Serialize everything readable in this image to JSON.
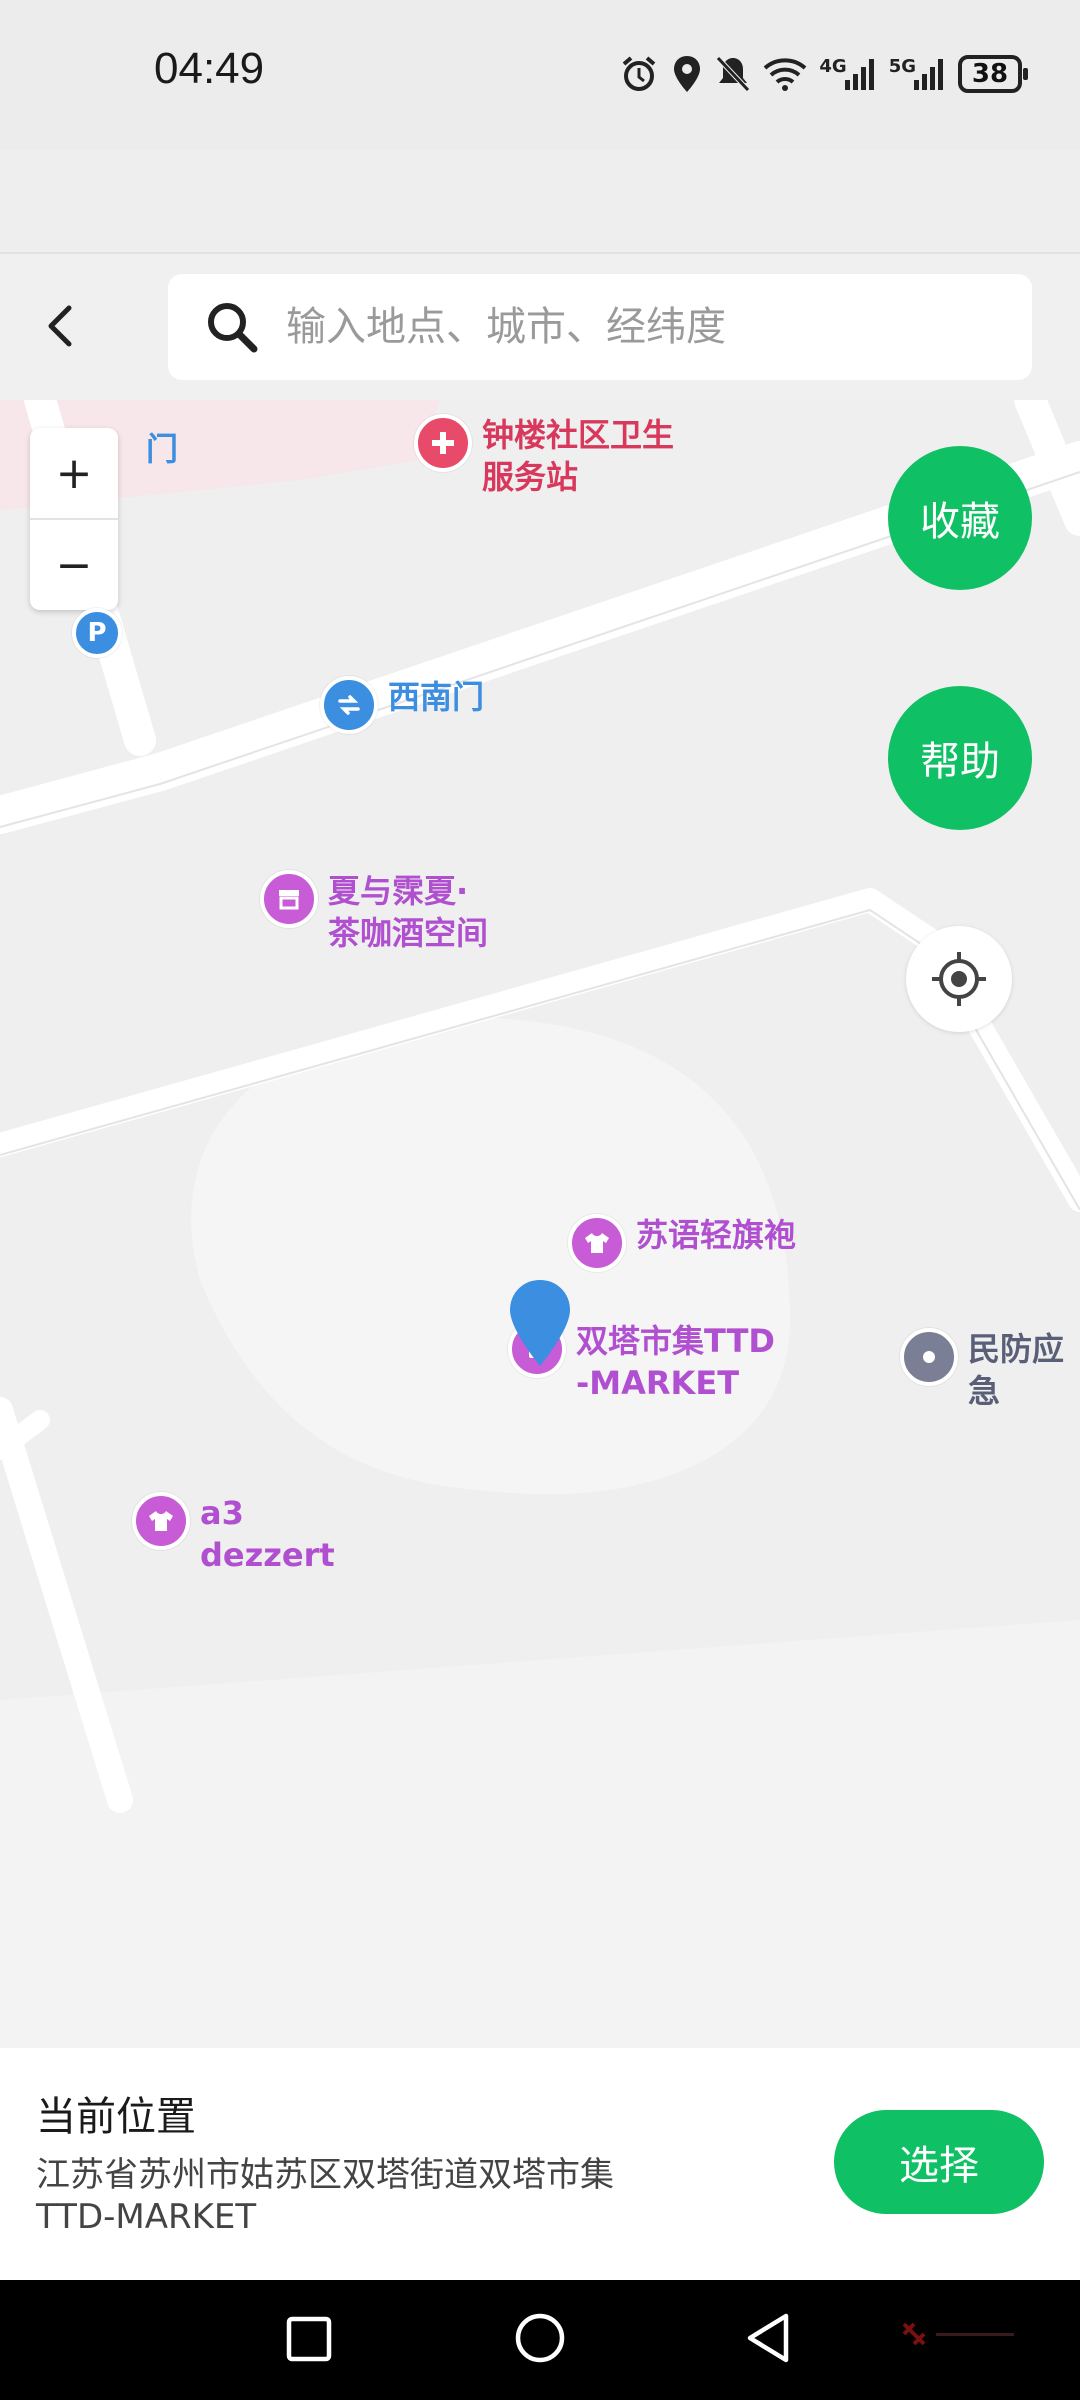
{
  "status_bar": {
    "time": "04:49",
    "battery": "38",
    "icons": [
      "alarm-icon",
      "location-icon",
      "mute-icon",
      "wifi-icon",
      "signal-4g-icon",
      "signal-5g-icon",
      "battery-icon"
    ],
    "net_4g": "4G",
    "net_5g": "5G"
  },
  "header": {
    "search_placeholder": "输入地点、城市、经纬度"
  },
  "map": {
    "zoom_in": "+",
    "zoom_out": "−",
    "favorite_button": "收藏",
    "help_button": "帮助",
    "pois": [
      {
        "label": "门",
        "type": "blue",
        "icon": "gate-icon"
      },
      {
        "label": "钟楼社区卫生\n服务站",
        "type": "red",
        "icon": "medical-cross-icon"
      },
      {
        "label": "西南门",
        "type": "blue",
        "icon": "gate-icon"
      },
      {
        "label": "夏与霂夏·\n茶咖酒空间",
        "type": "purple",
        "icon": "shop-icon"
      },
      {
        "label": "苏语轻旗袍",
        "type": "purple",
        "icon": "clothing-icon"
      },
      {
        "label": "双塔市集TTD\n-MARKET",
        "type": "purple",
        "icon": "shopping-bag-icon"
      },
      {
        "label": "民防应急",
        "type": "grey",
        "icon": "dot-icon"
      },
      {
        "label": "a3\ndezzert",
        "type": "purple",
        "icon": "clothing-icon"
      }
    ],
    "parking_label": "P",
    "colors": {
      "accent": "#10c064",
      "marker": "#3b8ee0",
      "road": "#ffffff",
      "background": "#efefef"
    }
  },
  "bottom_panel": {
    "title": "当前位置",
    "address": "江苏省苏州市姑苏区双塔街道双塔市集TTD-MARKET",
    "select_button": "选择"
  },
  "nav_bar": {
    "items": [
      "recent-apps-icon",
      "home-icon",
      "back-icon"
    ]
  }
}
